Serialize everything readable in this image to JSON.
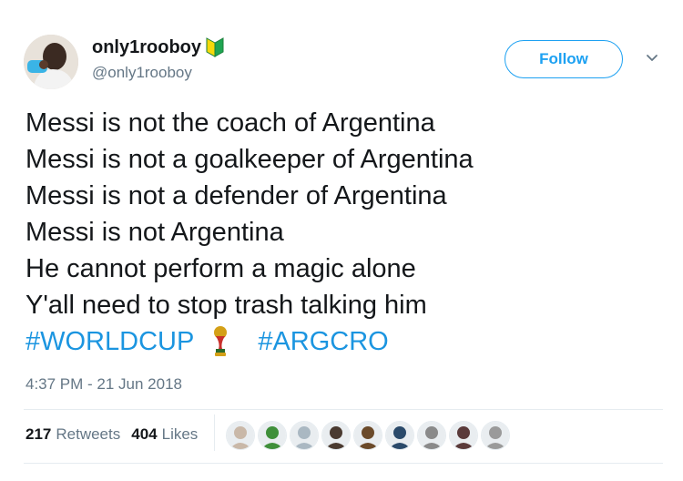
{
  "author": {
    "display_name": "only1rooboy",
    "handle": "@only1rooboy",
    "badge_icon": "beginner-shield-icon"
  },
  "follow_label": "Follow",
  "tweet": {
    "lines": [
      "Messi is not the coach of Argentina",
      "Messi is not a goalkeeper of Argentina",
      "Messi is not a defender of Argentina",
      "Messi is not Argentina",
      "He cannot perform a magic alone",
      "Y'all need to stop trash talking him"
    ],
    "hashtags": [
      "#WORLDCUP",
      "#ARGCRO"
    ],
    "emoji_icon": "world-cup-trophy-icon"
  },
  "timestamp": "4:37 PM - 21 Jun 2018",
  "stats": {
    "retweets_count": "217",
    "retweets_label": "Retweets",
    "likes_count": "404",
    "likes_label": "Likes"
  },
  "likers": [
    {
      "color": "#c9b8a8"
    },
    {
      "color": "#3f8f3a"
    },
    {
      "color": "#aab8c2"
    },
    {
      "color": "#4a3a30"
    },
    {
      "color": "#6b4a2a"
    },
    {
      "color": "#2b4a6a"
    },
    {
      "color": "#8a8a8a"
    },
    {
      "color": "#5a3a3a"
    },
    {
      "color": "#9a9a9a"
    }
  ],
  "colors": {
    "accent": "#1da1f2",
    "hashtag": "#1b95e0",
    "muted": "#657786",
    "text": "#14171a"
  }
}
